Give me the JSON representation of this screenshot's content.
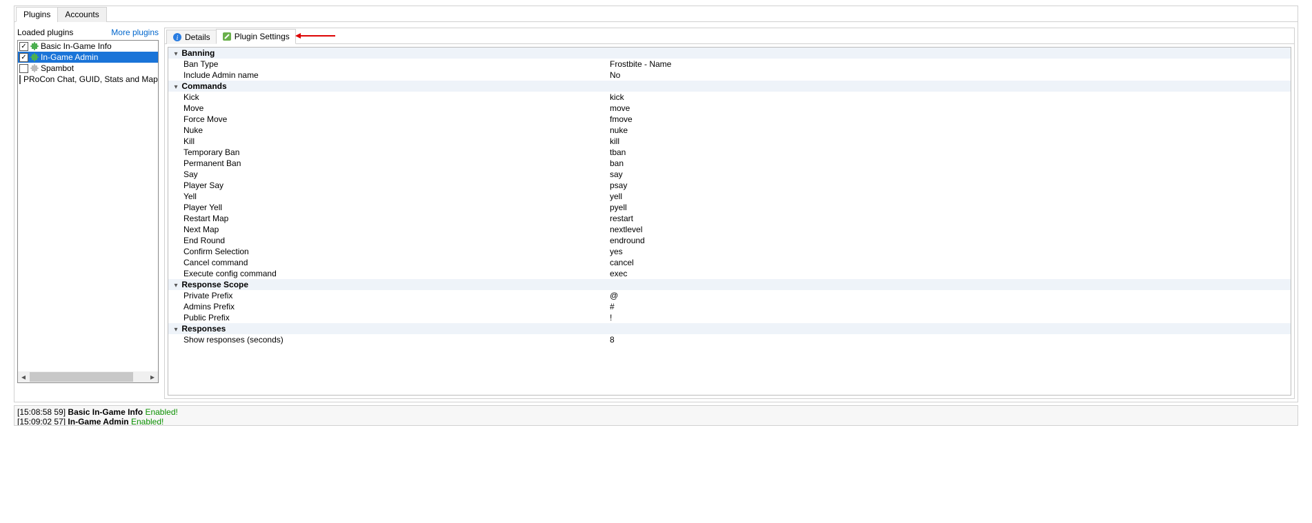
{
  "topTabs": {
    "plugins": "Plugins",
    "accounts": "Accounts"
  },
  "left": {
    "title": "Loaded plugins",
    "moreLink": "More plugins",
    "items": [
      {
        "label": "Basic In-Game Info",
        "checked": true,
        "selected": false,
        "enabled": true
      },
      {
        "label": "In-Game Admin",
        "checked": true,
        "selected": true,
        "enabled": true
      },
      {
        "label": "Spambot",
        "checked": false,
        "selected": false,
        "enabled": false
      },
      {
        "label": "PRoCon Chat, GUID, Stats and Map Logger",
        "checked": false,
        "selected": false,
        "enabled": false
      }
    ]
  },
  "subTabs": {
    "details": "Details",
    "settings": "Plugin Settings"
  },
  "settings": {
    "categories": [
      {
        "name": "Banning",
        "rows": [
          {
            "k": "Ban Type",
            "v": "Frostbite - Name"
          },
          {
            "k": "Include Admin name",
            "v": "No"
          }
        ]
      },
      {
        "name": "Commands",
        "rows": [
          {
            "k": "Kick",
            "v": "kick"
          },
          {
            "k": "Move",
            "v": "move"
          },
          {
            "k": "Force Move",
            "v": "fmove"
          },
          {
            "k": "Nuke",
            "v": "nuke"
          },
          {
            "k": "Kill",
            "v": "kill"
          },
          {
            "k": "Temporary Ban",
            "v": "tban"
          },
          {
            "k": "Permanent Ban",
            "v": "ban"
          },
          {
            "k": "Say",
            "v": "say"
          },
          {
            "k": "Player Say",
            "v": "psay"
          },
          {
            "k": "Yell",
            "v": "yell"
          },
          {
            "k": "Player Yell",
            "v": "pyell"
          },
          {
            "k": "Restart Map",
            "v": "restart"
          },
          {
            "k": "Next Map",
            "v": "nextlevel"
          },
          {
            "k": "End Round",
            "v": "endround"
          },
          {
            "k": "Confirm Selection",
            "v": "yes"
          },
          {
            "k": "Cancel command",
            "v": "cancel"
          },
          {
            "k": "Execute config command",
            "v": "exec"
          }
        ]
      },
      {
        "name": "Response Scope",
        "rows": [
          {
            "k": "Private Prefix",
            "v": "@"
          },
          {
            "k": "Admins Prefix",
            "v": "#"
          },
          {
            "k": "Public Prefix",
            "v": "!"
          }
        ]
      },
      {
        "name": "Responses",
        "rows": [
          {
            "k": "Show responses (seconds)",
            "v": "8"
          }
        ]
      }
    ]
  },
  "log": [
    {
      "ts": "[15:08:58 59]",
      "name": "Basic In-Game Info",
      "status": "Enabled!"
    },
    {
      "ts": "[15:09:02 57]",
      "name": "In-Game Admin",
      "status": "Enabled!"
    }
  ]
}
